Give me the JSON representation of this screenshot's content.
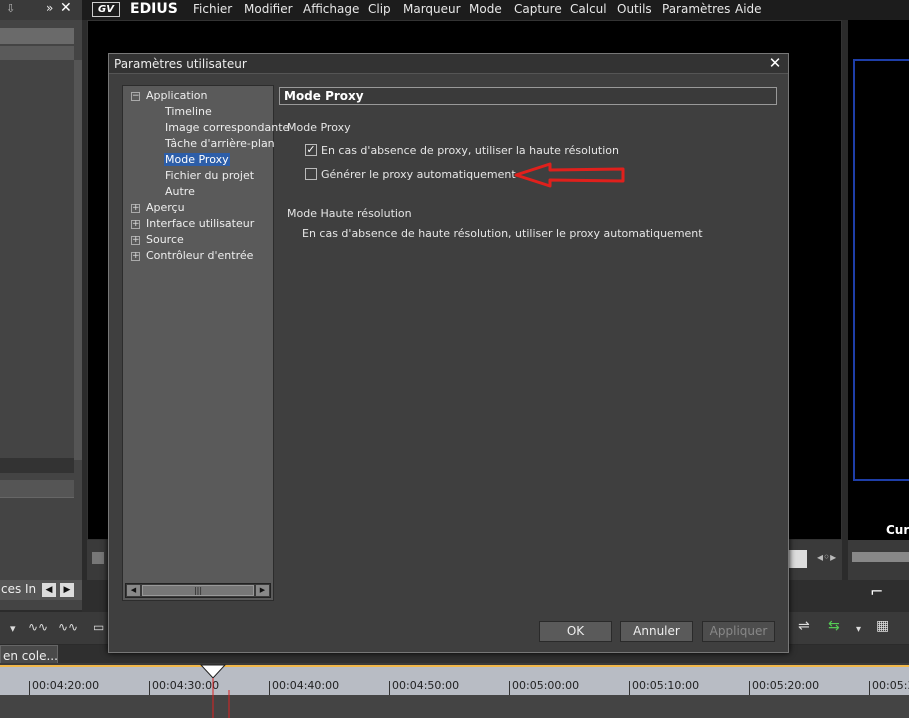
{
  "menubar": {
    "logo": "GV",
    "brand": "EDIUS",
    "items": [
      "Fichier",
      "Modifier",
      "Affichage",
      "Clip",
      "Marqueur",
      "Mode",
      "Capture",
      "Calcul",
      "Outils",
      "Paramètres",
      "Aide"
    ]
  },
  "dialog": {
    "title": "Paramètres utilisateur",
    "close": "✕",
    "tree": [
      {
        "label": "Application",
        "expander": "−"
      },
      {
        "label": "Timeline"
      },
      {
        "label": "Image correspondante"
      },
      {
        "label": "Tâche d'arrière-plan"
      },
      {
        "label": "Mode Proxy",
        "selected": true
      },
      {
        "label": "Fichier du projet"
      },
      {
        "label": "Autre"
      },
      {
        "label": "Aperçu",
        "expander": "+"
      },
      {
        "label": "Interface utilisateur",
        "expander": "+"
      },
      {
        "label": "Source",
        "expander": "+"
      },
      {
        "label": "Contrôleur d'entrée",
        "expander": "+"
      }
    ],
    "section_title": "Mode Proxy",
    "proxy_group_label": "Mode Proxy",
    "option_1": {
      "label": "En cas d'absence de proxy, utiliser la haute résolution",
      "checked": true
    },
    "option_2": {
      "label": "Générer le proxy automatiquement",
      "checked": false
    },
    "hires_group_label": "Mode Haute résolution",
    "hires_text": "En cas d'absence de haute résolution, utiliser le proxy automatiquement",
    "buttons": {
      "ok": "OK",
      "cancel": "Annuler",
      "apply": "Appliquer"
    },
    "annotation_arrow_color": "#e0201c"
  },
  "timeline": {
    "tab_label": "en cole...",
    "ticks": [
      "00:04:20:00",
      "00:04:30:00",
      "00:04:40:00",
      "00:04:50:00",
      "00:05:00:00",
      "00:05:10:00",
      "00:05:20:00",
      "00:05:3"
    ]
  },
  "left_panel": {
    "tab_1": "ces",
    "tab_2": "In"
  },
  "right_panel": {
    "cur_label": "Cur"
  }
}
